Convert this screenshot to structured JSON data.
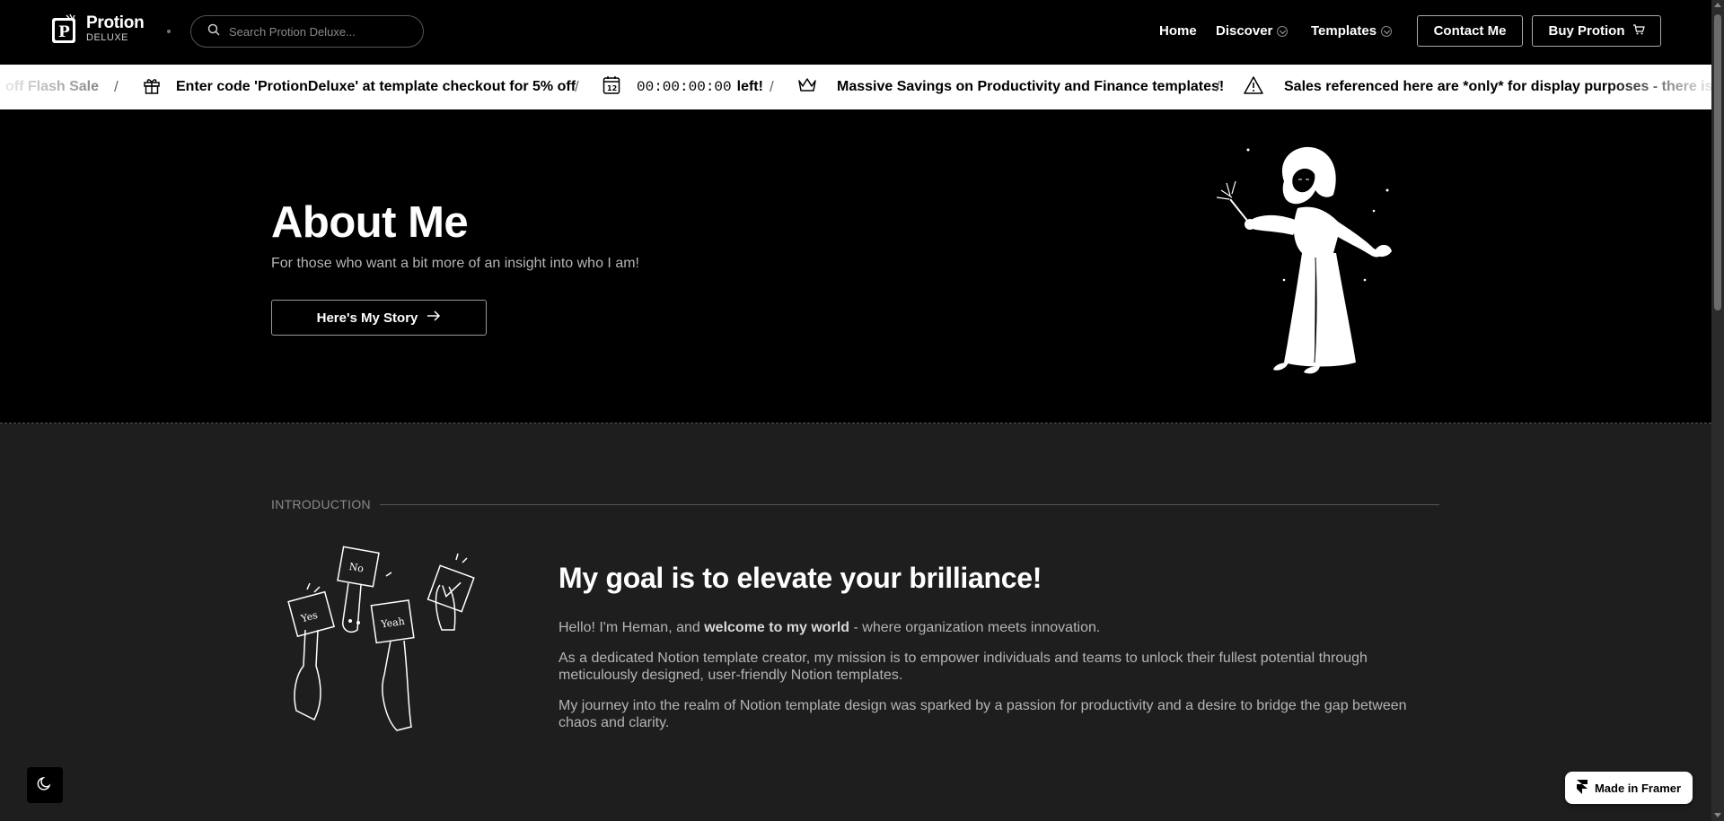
{
  "header": {
    "logo_title": "Protion",
    "logo_subtitle": "DELUXE",
    "search_placeholder": "Search Protion Deluxe...",
    "nav": {
      "home": "Home",
      "discover": "Discover",
      "templates": "Templates"
    },
    "contact_label": "Contact Me",
    "buy_label": "Buy Protion"
  },
  "ticker": {
    "item_flash": "off Flash Sale",
    "item_code": "Enter code 'ProtionDeluxe' at template checkout for 5% off",
    "countdown": "00:00:00:00",
    "countdown_suffix": "left!",
    "calendar_day": "12",
    "item_savings": "Massive Savings on Productivity and Finance templates!",
    "item_disclaimer": "Sales referenced here are *only* for display purposes - there is no",
    "separator": "/"
  },
  "hero": {
    "title": "About Me",
    "subtitle": "For those who want a bit more of an insight into who I am!",
    "button_label": "Here's My Story"
  },
  "intro": {
    "section_label": "INTRODUCTION",
    "heading": "My goal is to elevate your brilliance!",
    "p1_prefix": "Hello! I'm Heman, and ",
    "p1_bold": "welcome to my world",
    "p1_suffix": " - where organization meets innovation.",
    "p2": "As a dedicated Notion template creator, my mission is to empower individuals and teams to unlock their fullest potential through meticulously designed, user-friendly Notion templates.",
    "p3": "My journey into the realm of Notion template design was sparked by a passion for productivity and a desire to bridge the gap between chaos and clarity.",
    "sign_words": [
      "Yes",
      "No",
      "Yeah"
    ]
  },
  "footer_badges": {
    "framer_label": "Made in Framer"
  },
  "colors": {
    "background": "#000000",
    "section_background": "#1e1e1e",
    "ticker_background": "#ffffff",
    "text_primary": "#ffffff",
    "text_muted": "#b4b4b4"
  }
}
